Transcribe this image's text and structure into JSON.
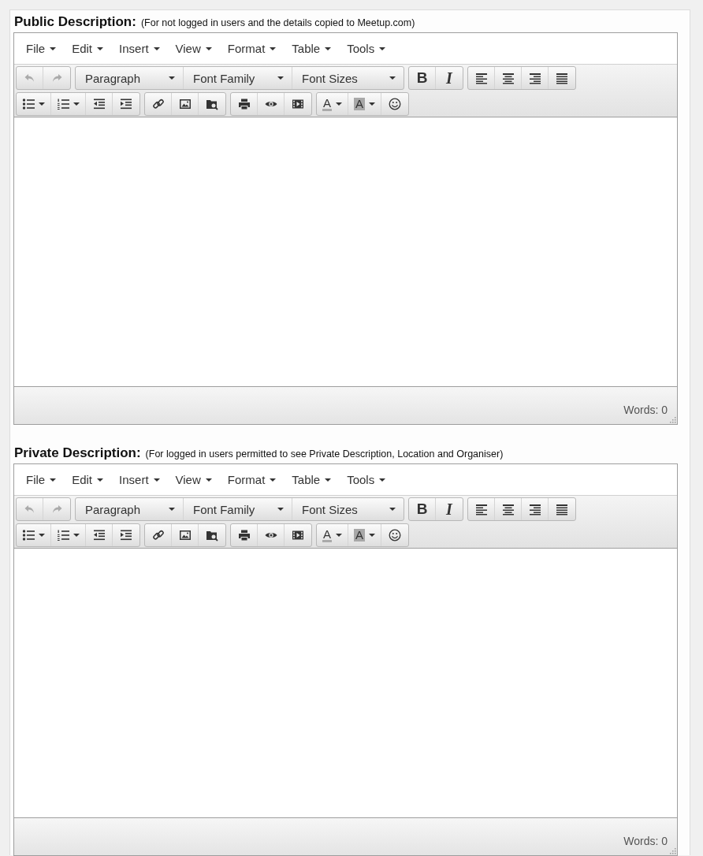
{
  "editors": [
    {
      "label": "Public Description:",
      "note": "(For not logged in users and the details copied to Meetup.com)",
      "menu": [
        "File",
        "Edit",
        "Insert",
        "View",
        "Format",
        "Table",
        "Tools"
      ],
      "toolbar": [
        [
          [
            {
              "kind": "undo",
              "disabled": true
            },
            {
              "kind": "redo",
              "disabled": true
            }
          ],
          [
            {
              "kind": "select",
              "label": "Paragraph",
              "disabled": false
            },
            {
              "kind": "select",
              "label": "Font Family",
              "disabled": false
            },
            {
              "kind": "select",
              "label": "Font Sizes",
              "disabled": false
            }
          ],
          [
            {
              "kind": "bold",
              "label": "B",
              "disabled": false
            },
            {
              "kind": "italic",
              "label": "I",
              "disabled": false
            }
          ],
          [
            {
              "kind": "alignleft",
              "disabled": false
            },
            {
              "kind": "aligncenter",
              "disabled": false
            },
            {
              "kind": "alignright",
              "disabled": false
            },
            {
              "kind": "justify",
              "disabled": false
            }
          ]
        ],
        [
          [
            {
              "kind": "bullist",
              "disabled": false
            },
            {
              "kind": "numlist",
              "disabled": false
            },
            {
              "kind": "outdent",
              "disabled": false
            },
            {
              "kind": "indent",
              "disabled": false
            }
          ],
          [
            {
              "kind": "link",
              "disabled": false
            },
            {
              "kind": "image",
              "disabled": false
            },
            {
              "kind": "browse",
              "disabled": false
            }
          ],
          [
            {
              "kind": "print",
              "disabled": false
            },
            {
              "kind": "preview",
              "disabled": false
            },
            {
              "kind": "media",
              "disabled": false
            }
          ],
          [
            {
              "kind": "forecolor",
              "label": "A",
              "disabled": false
            },
            {
              "kind": "backcolor",
              "label": "A",
              "disabled": false
            },
            {
              "kind": "emoticon",
              "disabled": false
            }
          ]
        ]
      ],
      "status": "Words: 0"
    },
    {
      "label": "Private Description:",
      "note": "(For logged in users permitted to see Private Description, Location and Organiser)",
      "menu": [
        "File",
        "Edit",
        "Insert",
        "View",
        "Format",
        "Table",
        "Tools"
      ],
      "toolbar": [
        [
          [
            {
              "kind": "undo",
              "disabled": true
            },
            {
              "kind": "redo",
              "disabled": true
            }
          ],
          [
            {
              "kind": "select",
              "label": "Paragraph",
              "disabled": false
            },
            {
              "kind": "select",
              "label": "Font Family",
              "disabled": false
            },
            {
              "kind": "select",
              "label": "Font Sizes",
              "disabled": false
            }
          ],
          [
            {
              "kind": "bold",
              "label": "B",
              "disabled": false
            },
            {
              "kind": "italic",
              "label": "I",
              "disabled": false
            }
          ],
          [
            {
              "kind": "alignleft",
              "disabled": false
            },
            {
              "kind": "aligncenter",
              "disabled": false
            },
            {
              "kind": "alignright",
              "disabled": false
            },
            {
              "kind": "justify",
              "disabled": false
            }
          ]
        ],
        [
          [
            {
              "kind": "bullist",
              "disabled": false
            },
            {
              "kind": "numlist",
              "disabled": false
            },
            {
              "kind": "outdent",
              "disabled": false
            },
            {
              "kind": "indent",
              "disabled": false
            }
          ],
          [
            {
              "kind": "link",
              "disabled": false
            },
            {
              "kind": "image",
              "disabled": false
            },
            {
              "kind": "browse",
              "disabled": false
            }
          ],
          [
            {
              "kind": "print",
              "disabled": false
            },
            {
              "kind": "preview",
              "disabled": false
            },
            {
              "kind": "media",
              "disabled": false
            }
          ],
          [
            {
              "kind": "forecolor",
              "label": "A",
              "disabled": false
            },
            {
              "kind": "backcolor",
              "label": "A",
              "disabled": false
            },
            {
              "kind": "emoticon",
              "disabled": false
            }
          ]
        ]
      ],
      "status": "Words: 0"
    }
  ]
}
